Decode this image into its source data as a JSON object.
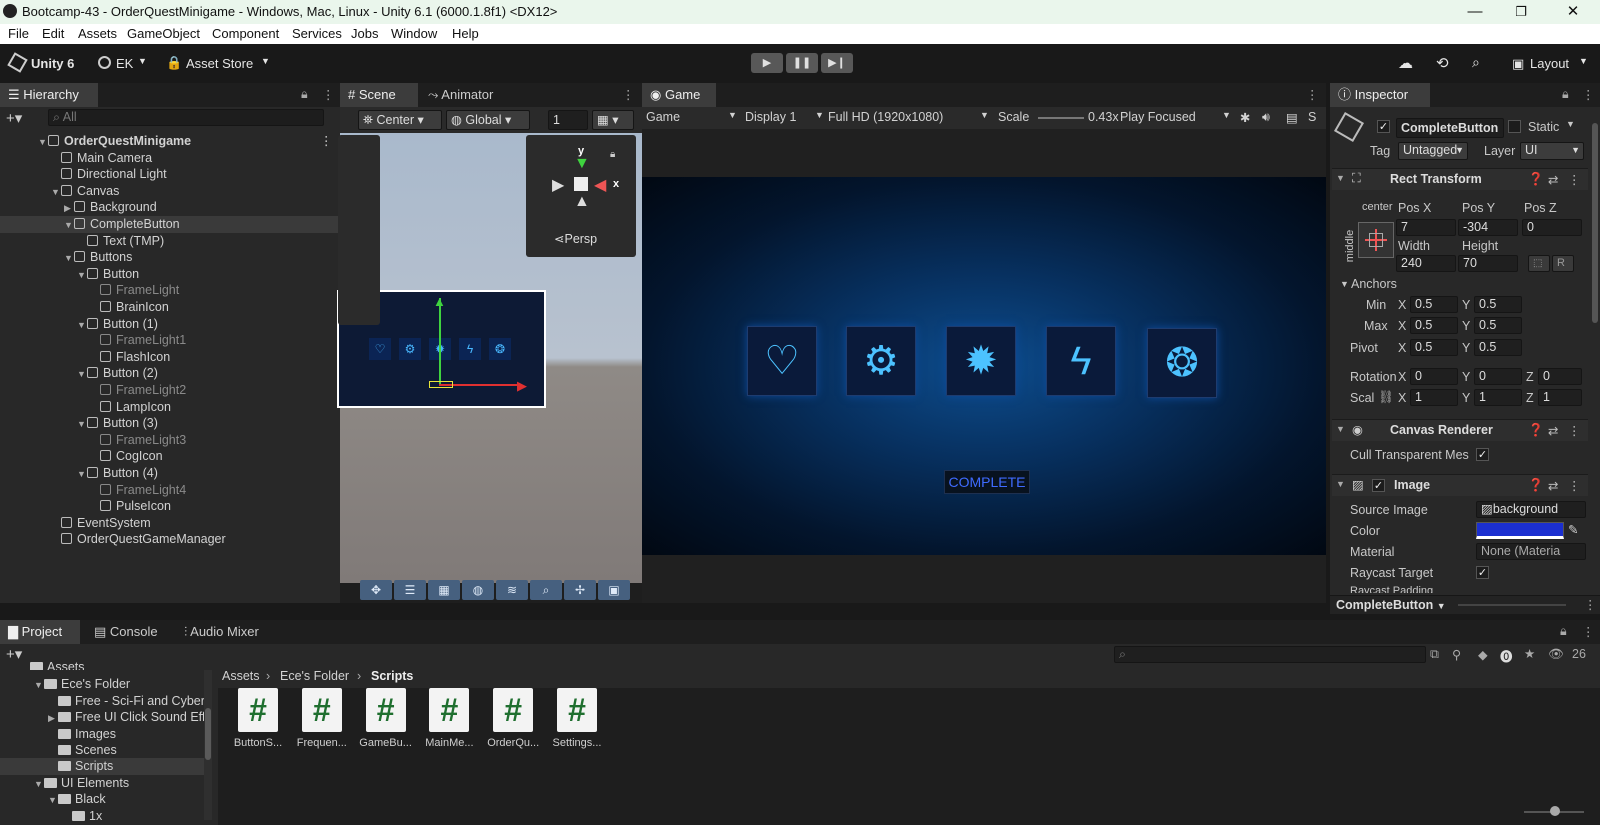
{
  "window": {
    "title": "Bootcamp-43 - OrderQuestMinigame - Windows, Mac, Linux - Unity 6.1 (6000.1.8f1) <DX12>",
    "minimize": "—",
    "maximize": "❐",
    "close": "✕"
  },
  "menu": [
    "File",
    "Edit",
    "Assets",
    "GameObject",
    "Component",
    "Services",
    "Jobs",
    "Window",
    "Help"
  ],
  "toolbar": {
    "unity_label": "Unity 6",
    "account": "EK",
    "asset_store": "Asset Store",
    "layout": "Layout"
  },
  "hierarchy": {
    "tab": "Hierarchy",
    "search_placeholder": "All",
    "items": [
      {
        "label": "OrderQuestMinigame",
        "depth": 0,
        "expanded": true,
        "root": true
      },
      {
        "label": "Main Camera",
        "depth": 1
      },
      {
        "label": "Directional Light",
        "depth": 1
      },
      {
        "label": "Canvas",
        "depth": 1,
        "expanded": true
      },
      {
        "label": "Background",
        "depth": 2,
        "collapsed": true
      },
      {
        "label": "CompleteButton",
        "depth": 2,
        "expanded": true,
        "selected": true
      },
      {
        "label": "Text (TMP)",
        "depth": 3
      },
      {
        "label": "Buttons",
        "depth": 2,
        "expanded": true
      },
      {
        "label": "Button",
        "depth": 3,
        "expanded": true
      },
      {
        "label": "FrameLight",
        "depth": 4,
        "dim": true
      },
      {
        "label": "BrainIcon",
        "depth": 4
      },
      {
        "label": "Button (1)",
        "depth": 3,
        "expanded": true
      },
      {
        "label": "FrameLight1",
        "depth": 4,
        "dim": true
      },
      {
        "label": "FlashIcon",
        "depth": 4
      },
      {
        "label": "Button (2)",
        "depth": 3,
        "expanded": true
      },
      {
        "label": "FrameLight2",
        "depth": 4,
        "dim": true
      },
      {
        "label": "LampIcon",
        "depth": 4
      },
      {
        "label": "Button (3)",
        "depth": 3,
        "expanded": true
      },
      {
        "label": "FrameLight3",
        "depth": 4,
        "dim": true
      },
      {
        "label": "CogIcon",
        "depth": 4
      },
      {
        "label": "Button (4)",
        "depth": 3,
        "expanded": true
      },
      {
        "label": "FrameLight4",
        "depth": 4,
        "dim": true
      },
      {
        "label": "PulseIcon",
        "depth": 4
      },
      {
        "label": "EventSystem",
        "depth": 1
      },
      {
        "label": "OrderQuestGameManager",
        "depth": 1
      }
    ]
  },
  "scene": {
    "tab_scene": "Scene",
    "tab_animator": "Animator",
    "pivot": "Center",
    "space": "Global",
    "grid_value": "1",
    "persp": "Persp",
    "axis_x": "x",
    "axis_y": "y"
  },
  "game": {
    "tab": "Game",
    "mode": "Game",
    "display": "Display 1",
    "resolution": "Full HD (1920x1080)",
    "scale_label": "Scale",
    "scale_value": "0.43x",
    "play_mode": "Play Focused",
    "complete_button": "COMPLETE"
  },
  "inspector": {
    "tab": "Inspector",
    "object_name": "CompleteButton",
    "static": "Static",
    "tag_label": "Tag",
    "tag": "Untagged",
    "layer_label": "Layer",
    "layer": "UI",
    "rect_transform": {
      "title": "Rect Transform",
      "anchor_h": "center",
      "anchor_v": "middle",
      "pos_x_label": "Pos X",
      "pos_y_label": "Pos Y",
      "pos_z_label": "Pos Z",
      "pos_x": "7",
      "pos_y": "-304",
      "pos_z": "0",
      "width_label": "Width",
      "height_label": "Height",
      "width": "240",
      "height": "70",
      "r_label": "R",
      "anchors_label": "Anchors",
      "min_label": "Min",
      "max_label": "Max",
      "pivot_label": "Pivot",
      "x": "X",
      "y": "Y",
      "z": "Z",
      "min_x": "0.5",
      "min_y": "0.5",
      "max_x": "0.5",
      "max_y": "0.5",
      "pivot_x": "0.5",
      "pivot_y": "0.5",
      "rotation_label": "Rotation",
      "rot_x": "0",
      "rot_y": "0",
      "rot_z": "0",
      "scale_label": "Scal",
      "scale_x": "1",
      "scale_y": "1",
      "scale_z": "1"
    },
    "canvas_renderer": {
      "title": "Canvas Renderer",
      "cull": "Cull Transparent Mes"
    },
    "image": {
      "title": "Image",
      "source_label": "Source Image",
      "source": "background",
      "color_label": "Color",
      "color": "#1b2fd0",
      "material_label": "Material",
      "material": "None (Materia",
      "raycast_label": "Raycast Target",
      "raycast_padding": "Raycast Padding"
    },
    "footer": "CompleteButton"
  },
  "project": {
    "tabs": [
      "Project",
      "Console",
      "Audio Mixer"
    ],
    "tree": [
      {
        "label": "Assets",
        "depth": 0
      },
      {
        "label": "Ece's Folder",
        "depth": 1,
        "expanded": true
      },
      {
        "label": "Free - Sci-Fi and Cyber",
        "depth": 2
      },
      {
        "label": "Free UI Click Sound Eff",
        "depth": 2,
        "collapsed": true
      },
      {
        "label": "Images",
        "depth": 2
      },
      {
        "label": "Scenes",
        "depth": 2
      },
      {
        "label": "Scripts",
        "depth": 2,
        "selected": true
      },
      {
        "label": "UI Elements",
        "depth": 1,
        "expanded": true
      },
      {
        "label": "Black",
        "depth": 2,
        "expanded": true
      },
      {
        "label": "1x",
        "depth": 3
      }
    ],
    "breadcrumb": [
      "Assets",
      "Ece's Folder",
      "Scripts"
    ],
    "files": [
      "ButtonS...",
      "Frequen...",
      "GameBu...",
      "MainMe...",
      "OrderQu...",
      "Settings..."
    ],
    "hidden_count": "26"
  }
}
